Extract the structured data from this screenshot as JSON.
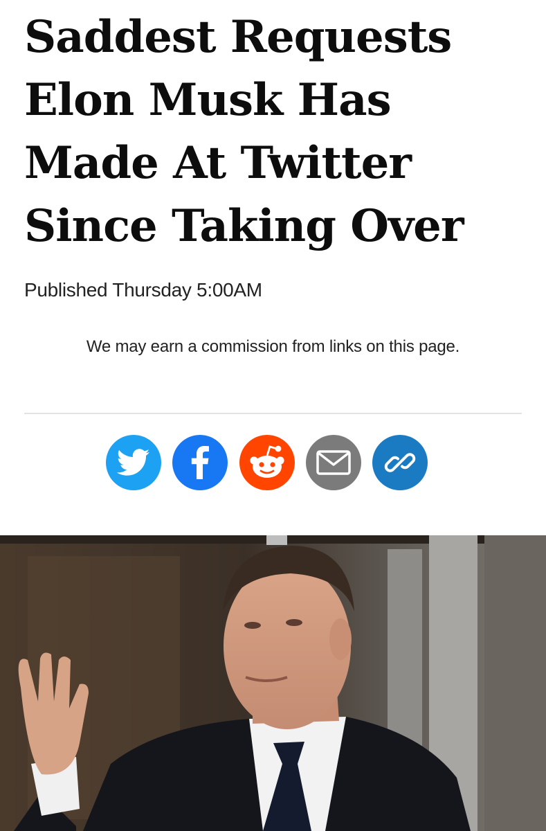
{
  "article": {
    "headline": "Saddest Requests Elon Musk Has Made At Twitter Since Taking Over",
    "byline_prefix": "Published",
    "byline_time": "Thursday 5:00AM",
    "disclosure": "We may earn a commission from links on this page."
  },
  "share": {
    "buttons": [
      {
        "name": "twitter",
        "color": "#1da1f2",
        "icon": "twitter-bird-icon"
      },
      {
        "name": "facebook",
        "color": "#1877f2",
        "icon": "facebook-f-icon"
      },
      {
        "name": "reddit",
        "color": "#ff4500",
        "icon": "reddit-alien-icon"
      },
      {
        "name": "email",
        "color": "#7b7b7b",
        "icon": "envelope-icon"
      },
      {
        "name": "link",
        "color": "#1a7bc2",
        "icon": "chain-link-icon"
      }
    ]
  },
  "hero_image": {
    "subject": "photo-man-waving"
  }
}
